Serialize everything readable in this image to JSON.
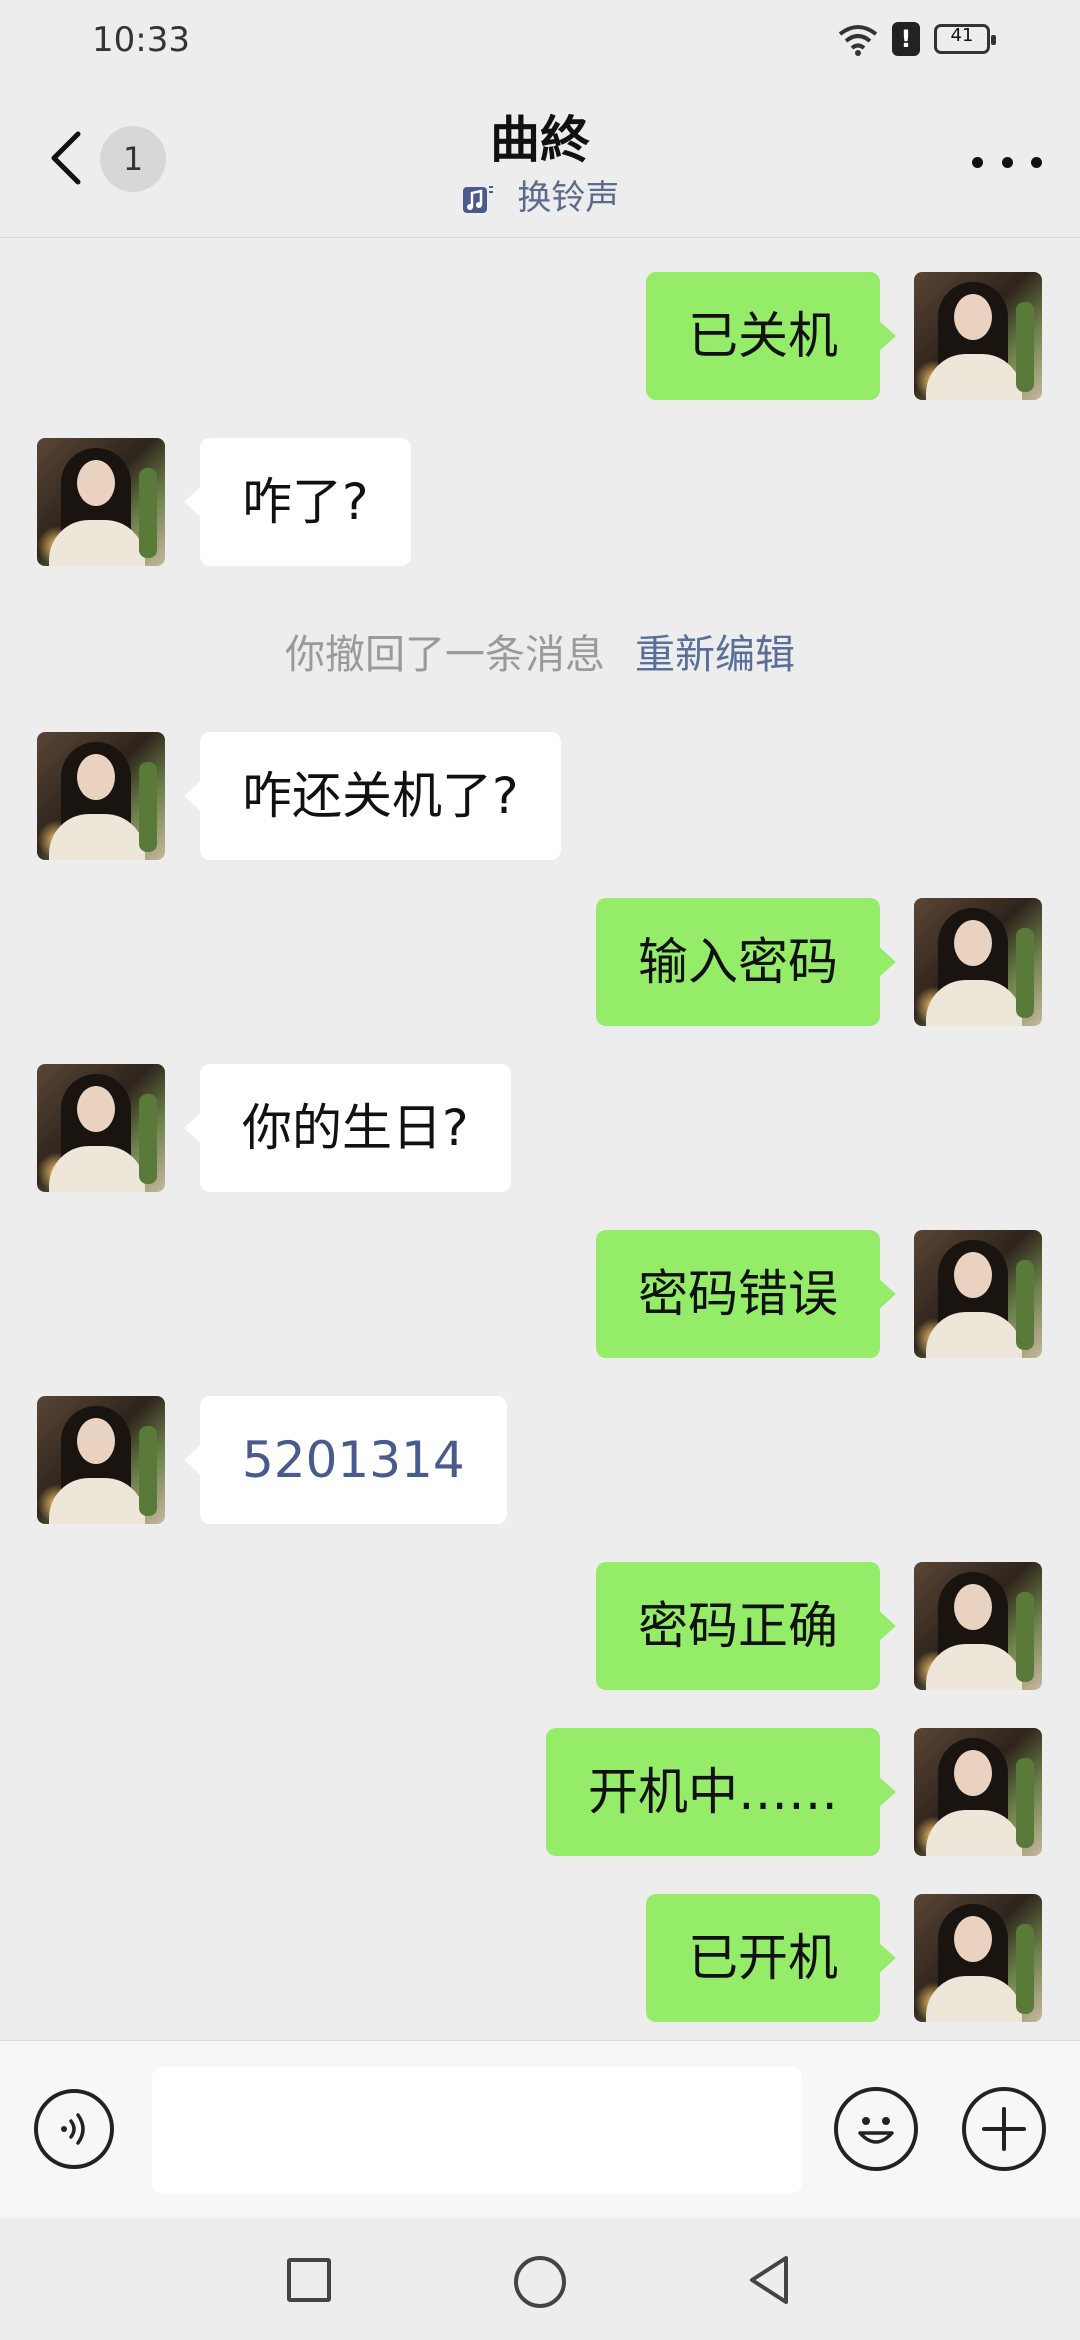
{
  "status_bar": {
    "time": "10:33",
    "battery": "41"
  },
  "header": {
    "unread_count": "1",
    "title": "曲終",
    "subtitle": "换铃声"
  },
  "messages": [
    {
      "side": "sent",
      "text": "已关机"
    },
    {
      "side": "recv",
      "text": "咋了?"
    },
    {
      "side": "system",
      "text": "你撤回了一条消息",
      "action": "重新编辑"
    },
    {
      "side": "recv",
      "text": "咋还关机了?"
    },
    {
      "side": "sent",
      "text": "输入密码"
    },
    {
      "side": "recv",
      "text": "你的生日?"
    },
    {
      "side": "sent",
      "text": "密码错误"
    },
    {
      "side": "recv",
      "text": "5201314"
    },
    {
      "side": "sent",
      "text": "密码正确"
    },
    {
      "side": "sent",
      "text": "开机中……"
    },
    {
      "side": "sent",
      "text": "已开机"
    }
  ],
  "input": {
    "value": "",
    "placeholder": ""
  },
  "colors": {
    "sent_bubble": "#95ec69",
    "recv_bubble": "#ffffff",
    "background": "#ededed",
    "link": "#5a6e9c"
  },
  "icons": [
    "back-icon",
    "music-note-icon",
    "more-icon",
    "voice-icon",
    "emoji-icon",
    "plus-icon",
    "wifi-icon",
    "battery-icon"
  ]
}
